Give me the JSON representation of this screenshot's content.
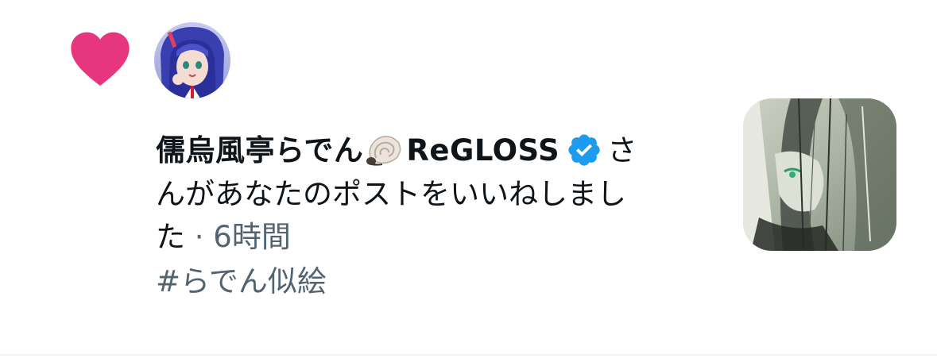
{
  "notification": {
    "user_name": "儒烏風亭らでん",
    "name_suffix": "ReGLOSS",
    "action_line1_tail": "さ",
    "action_line2": "んがあなたのポストをいいねしまし",
    "action_line3": "た",
    "separator": " · ",
    "time_ago": "6時間",
    "hashtag": "#らでん似絵"
  },
  "icons": {
    "like": "heart-icon",
    "name_emoji": "spiral-shell-icon",
    "verified": "verified-badge-icon"
  },
  "colors": {
    "like": "#e8357f",
    "verified": "#1d9bf0",
    "text_primary": "#0f1419",
    "text_secondary": "#536471",
    "divider": "#eff3f4"
  }
}
